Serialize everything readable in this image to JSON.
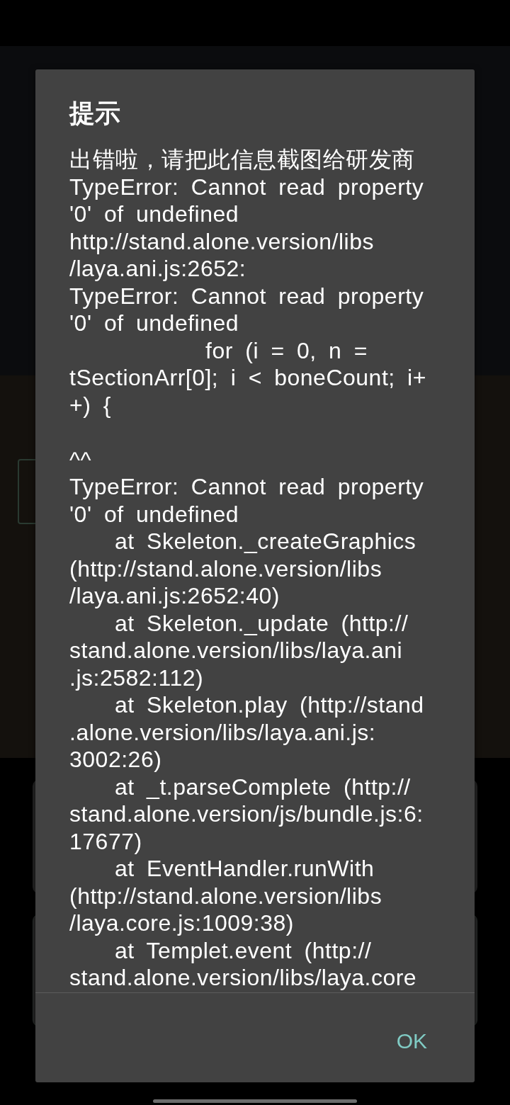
{
  "dialog": {
    "title": "提示",
    "message": [
      {
        "kind": "text",
        "lines": [
          "出错啦，请把此信息截图给研发商"
        ]
      },
      {
        "kind": "text",
        "lines": [
          "TypeError: Cannot read property",
          "'0' of undefined"
        ]
      },
      {
        "kind": "text",
        "lines": [
          "http://stand.alone.version/libs",
          "/laya.ani.js:2652:"
        ]
      },
      {
        "kind": "text",
        "lines": [
          "TypeError: Cannot read property",
          "'0' of undefined"
        ]
      },
      {
        "kind": "code",
        "lines": [
          "for (i = 0, n =",
          "tSectionArr[0]; i < boneCount; i+",
          "+) {"
        ]
      },
      {
        "kind": "caret",
        "lines": [
          "^^"
        ]
      },
      {
        "kind": "text",
        "lines": [
          "TypeError: Cannot read property",
          "'0' of undefined"
        ]
      },
      {
        "kind": "stack",
        "lines": [
          "at Skeleton._createGraphics",
          "(http://stand.alone.version/libs",
          "/laya.ani.js:2652:40)"
        ]
      },
      {
        "kind": "stack",
        "lines": [
          "at Skeleton._update (http://",
          "stand.alone.version/libs/laya.ani",
          ".js:2582:112)"
        ]
      },
      {
        "kind": "stack",
        "lines": [
          "at Skeleton.play (http://stand",
          ".alone.version/libs/laya.ani.js:",
          "3002:26)"
        ]
      },
      {
        "kind": "stack",
        "lines": [
          "at _t.parseComplete (http://",
          "stand.alone.version/js/bundle.js:6:",
          "17677)"
        ]
      },
      {
        "kind": "stack",
        "lines": [
          "at EventHandler.runWith",
          "(http://stand.alone.version/libs",
          "/laya.core.js:1009:38)"
        ]
      },
      {
        "kind": "stack",
        "lines": [
          "at Templet.event (http://",
          "stand.alone.version/libs/laya.core"
        ]
      }
    ],
    "buttons": [
      "OK"
    ]
  }
}
